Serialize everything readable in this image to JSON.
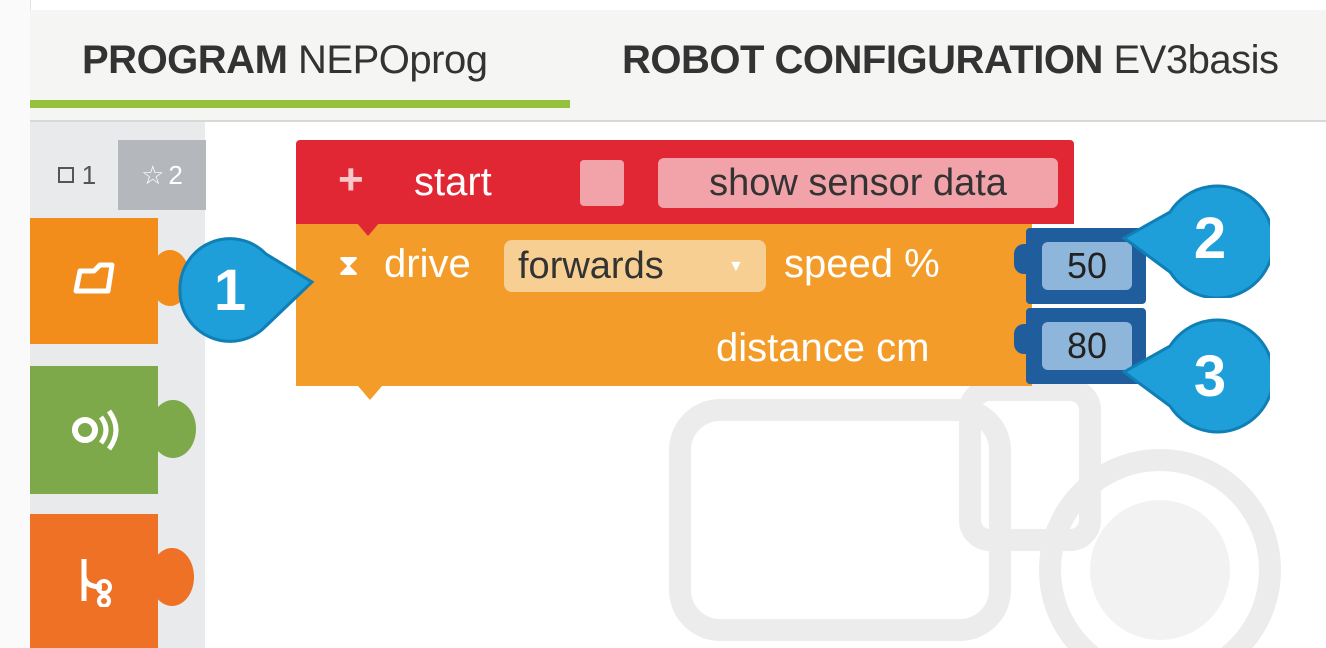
{
  "tabs": {
    "program_label": "PROGRAM",
    "program_name": "NEPOprog",
    "robot_label": "ROBOT CONFIGURATION",
    "robot_name": "EV3basis"
  },
  "toolbox": {
    "level1": "1",
    "level2": "2",
    "categories": [
      {
        "name": "drive",
        "icon": "steering-icon",
        "color": "#f28c1b"
      },
      {
        "name": "sensors",
        "icon": "sensor-icon",
        "color": "#7ea94a"
      },
      {
        "name": "control",
        "icon": "branch-icon",
        "color": "#ee7126"
      }
    ]
  },
  "start_block": {
    "plus": "+",
    "label": "start",
    "checkbox_checked": false,
    "show_sensor_data": "show sensor data",
    "color": "#e12734"
  },
  "drive_block": {
    "label": "drive",
    "direction": "forwards",
    "speed_label": "speed %",
    "speed_value": "50",
    "distance_label": "distance cm",
    "distance_value": "80",
    "color": "#f39c2a"
  },
  "callouts": [
    "1",
    "2",
    "3"
  ],
  "colors": {
    "accent_green": "#95c13d",
    "callout_blue": "#1e9fd9",
    "number_block": "#1f5d9c"
  }
}
